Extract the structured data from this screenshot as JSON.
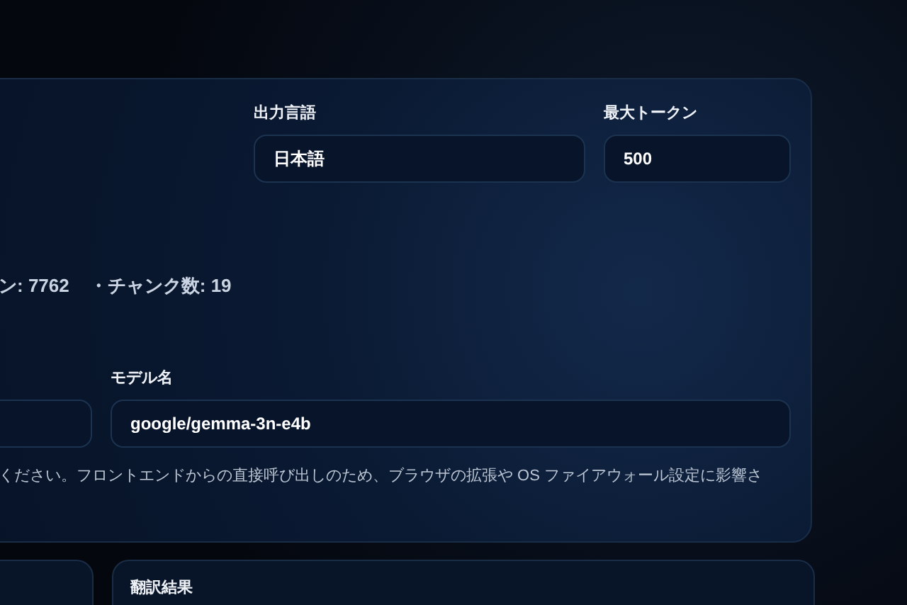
{
  "settings_panel": {
    "fields_top": [
      {
        "label": "出力言語",
        "value": "日本語"
      },
      {
        "label": "最大トークン",
        "value": "500"
      }
    ],
    "stats": [
      "ン: 7762",
      "・チャンク数: 19"
    ],
    "model_field": {
      "label": "モデル名",
      "value": "google/gemma-3n-e4b"
    },
    "note": "ください。フロントエンドからの直接呼び出しのため、ブラウザの拡張や OS ファイアウォール設定に影響さ"
  },
  "result_card": {
    "title": "翻訳結果"
  }
}
